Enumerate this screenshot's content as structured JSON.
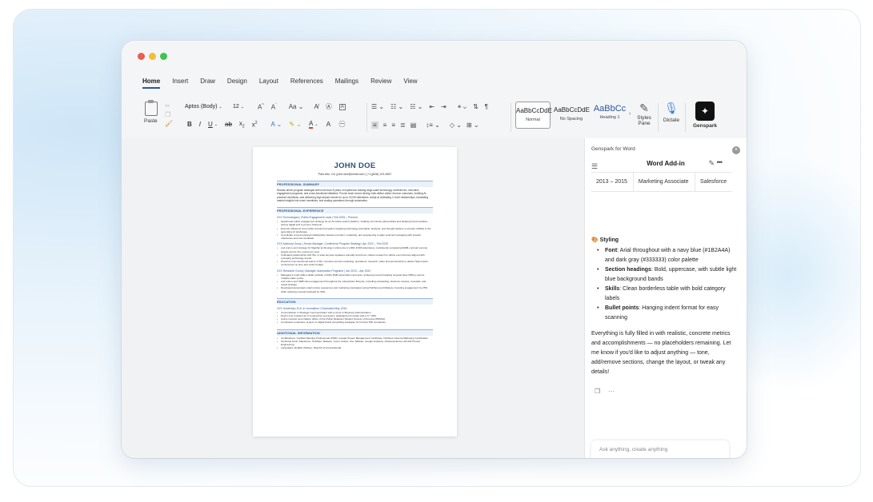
{
  "window": {
    "ribbon_tabs": [
      "Home",
      "Insert",
      "Draw",
      "Design",
      "Layout",
      "References",
      "Mailings",
      "Review",
      "View"
    ],
    "active_tab": "Home"
  },
  "toolbar": {
    "paste_label": "Paste",
    "font_name": "Aptos (Body)",
    "font_size": "12",
    "styles": [
      {
        "preview": "AaBbCcDdE",
        "name": "Normal"
      },
      {
        "preview": "AaBbCcDdE",
        "name": "No Spacing"
      },
      {
        "preview": "AaBbCc",
        "name": "Heading 1"
      }
    ],
    "styles_pane_label": "Styles Pane",
    "dictate_label": "Dictate",
    "genspark_label": "Genspark"
  },
  "resume": {
    "name": "JOHN DOE",
    "contact": "Palo Alto, CA  |  john.doe@email.com  |  (+1)(628) 123-4567",
    "summary_title": "PROFESSIONAL SUMMARY",
    "summary_text": "Results-driven program strategist with more than 8 years of experience leading large-scale technology conferences, executive engagement programs, and cross-functional initiatives. Proven track record driving multi-million-dollar revenue outcomes, building AI-powered workflows, and delivering high-impact events for up to 15,000 attendees. Adept at cultivating C-level relationships, translating market insights into event narratives, and scaling operations through automation.",
    "experience_title": "PROFESSIONAL EXPERIENCE",
    "jobs": [
      {
        "header": "XXX Technologies  |  Public Engagement Lead  |  Feb 2025 – Present",
        "bullets": [
          "Spearhead public engagement strategy for an AI-native search platform, building community partnerships and shaping brand narrative across digital and in-person channels.",
          "Execute influencer and media outreach programs targeting technology journalists, analysts, and thought leaders to elevate visibility in the generative AI landscape.",
          "Coordinate cross-functional collaboration between product, marketing, and engineering to align external messaging with product milestones and user feedback."
        ]
      },
      {
        "header": "XXX Advisory Group  |  Senior Manager, Conference Program Strategy  |  Apr 2022 – Feb 2025",
        "bullets": [
          "Led end-to-end strategy for flagship technology conferences (1,000–8,000 attendees), consistently surpassing $10M+ annual revenue targets across 12+ events per year.",
          "Cultivated relationships with 50+ C-suite keynote speakers annually and drove market research to define event themes aligned with emerging technology trends.",
          "Directed cross-functional teams of 30+ members across marketing, operations, research, sales and sponsorship to deliver high-impact conferences on time and under budget."
        ]
      },
      {
        "header": "XXX Research Group  |  Manager, Automation Programs  |  Jun 2019 – Apr 2022",
        "bullets": [
          "Managed a multi-million-dollar portfolio of 300+ B2B subscription accounts, achieving record-breaking renewal rates (95%+) across multiple sales cycles.",
          "Led end-to-end SMB client engagement throughout the subscription lifecycle, including onboarding, business reviews, renewals, and upsell strategy.",
          "Developed automated email nurture sequences and marketing campaigns using HubSpot and Marketo, boosting engagement by 25% while reducing manual workload by 40%."
        ]
      }
    ],
    "education_title": "EDUCATION",
    "education_header": "XXX University  |  B.A. in Journalism  |  Graduated May 2016",
    "education_bullets": [
      "Concentration in Strategic Communication with a minor in Business Administration.",
      "Dean's List recipient for 6 consecutive semesters, graduated cum laude with a 3.7 GPA.",
      "Active member and chapter officer of the Public Relations Student Society of America (PRSSA).",
      "Completed a capstone project on digital brand storytelling strategies for Fortune 500 companies."
    ],
    "additional_title": "ADDITIONAL INFORMATION",
    "additional_bullets": [
      "Certifications: Certified Meeting Professional (CMP), Google Project Management Certificate, HubSpot Inbound Marketing Certification",
      "Technical Tools: Salesforce, HubSpot, Marketo, Cvent, Asana, Jira, Tableau, Google Analytics, Advanced Excel, AI/LLM Prompt Engineering",
      "Languages: English (Native), Spanish (Conversational)"
    ]
  },
  "panel": {
    "title": "Genspark for Word",
    "header": "Word Add-in",
    "table_row": [
      "2013 – 2015",
      "Marketing Associate",
      "Salesforce"
    ],
    "styling_heading": "Styling",
    "bullets": [
      {
        "label": "Font",
        "text": ": Arial throughout with a navy blue (#1B2A4A) and dark gray (#333333) color palette"
      },
      {
        "label": "Section headings",
        "text": ": Bold, uppercase, with subtle light blue background bands"
      },
      {
        "label": "Skills",
        "text": ": Clean borderless table with bold category labels"
      },
      {
        "label": "Bullet points",
        "text": ": Hanging indent format for easy scanning"
      }
    ],
    "summary": "Everything is fully filled in with realistic, concrete metrics and accomplishments — no placeholders remaining. Let me know if you'd like to adjust anything — tone, add/remove sections, change the layout, or tweak any details!",
    "input_placeholder": "Ask anything, create anything"
  }
}
